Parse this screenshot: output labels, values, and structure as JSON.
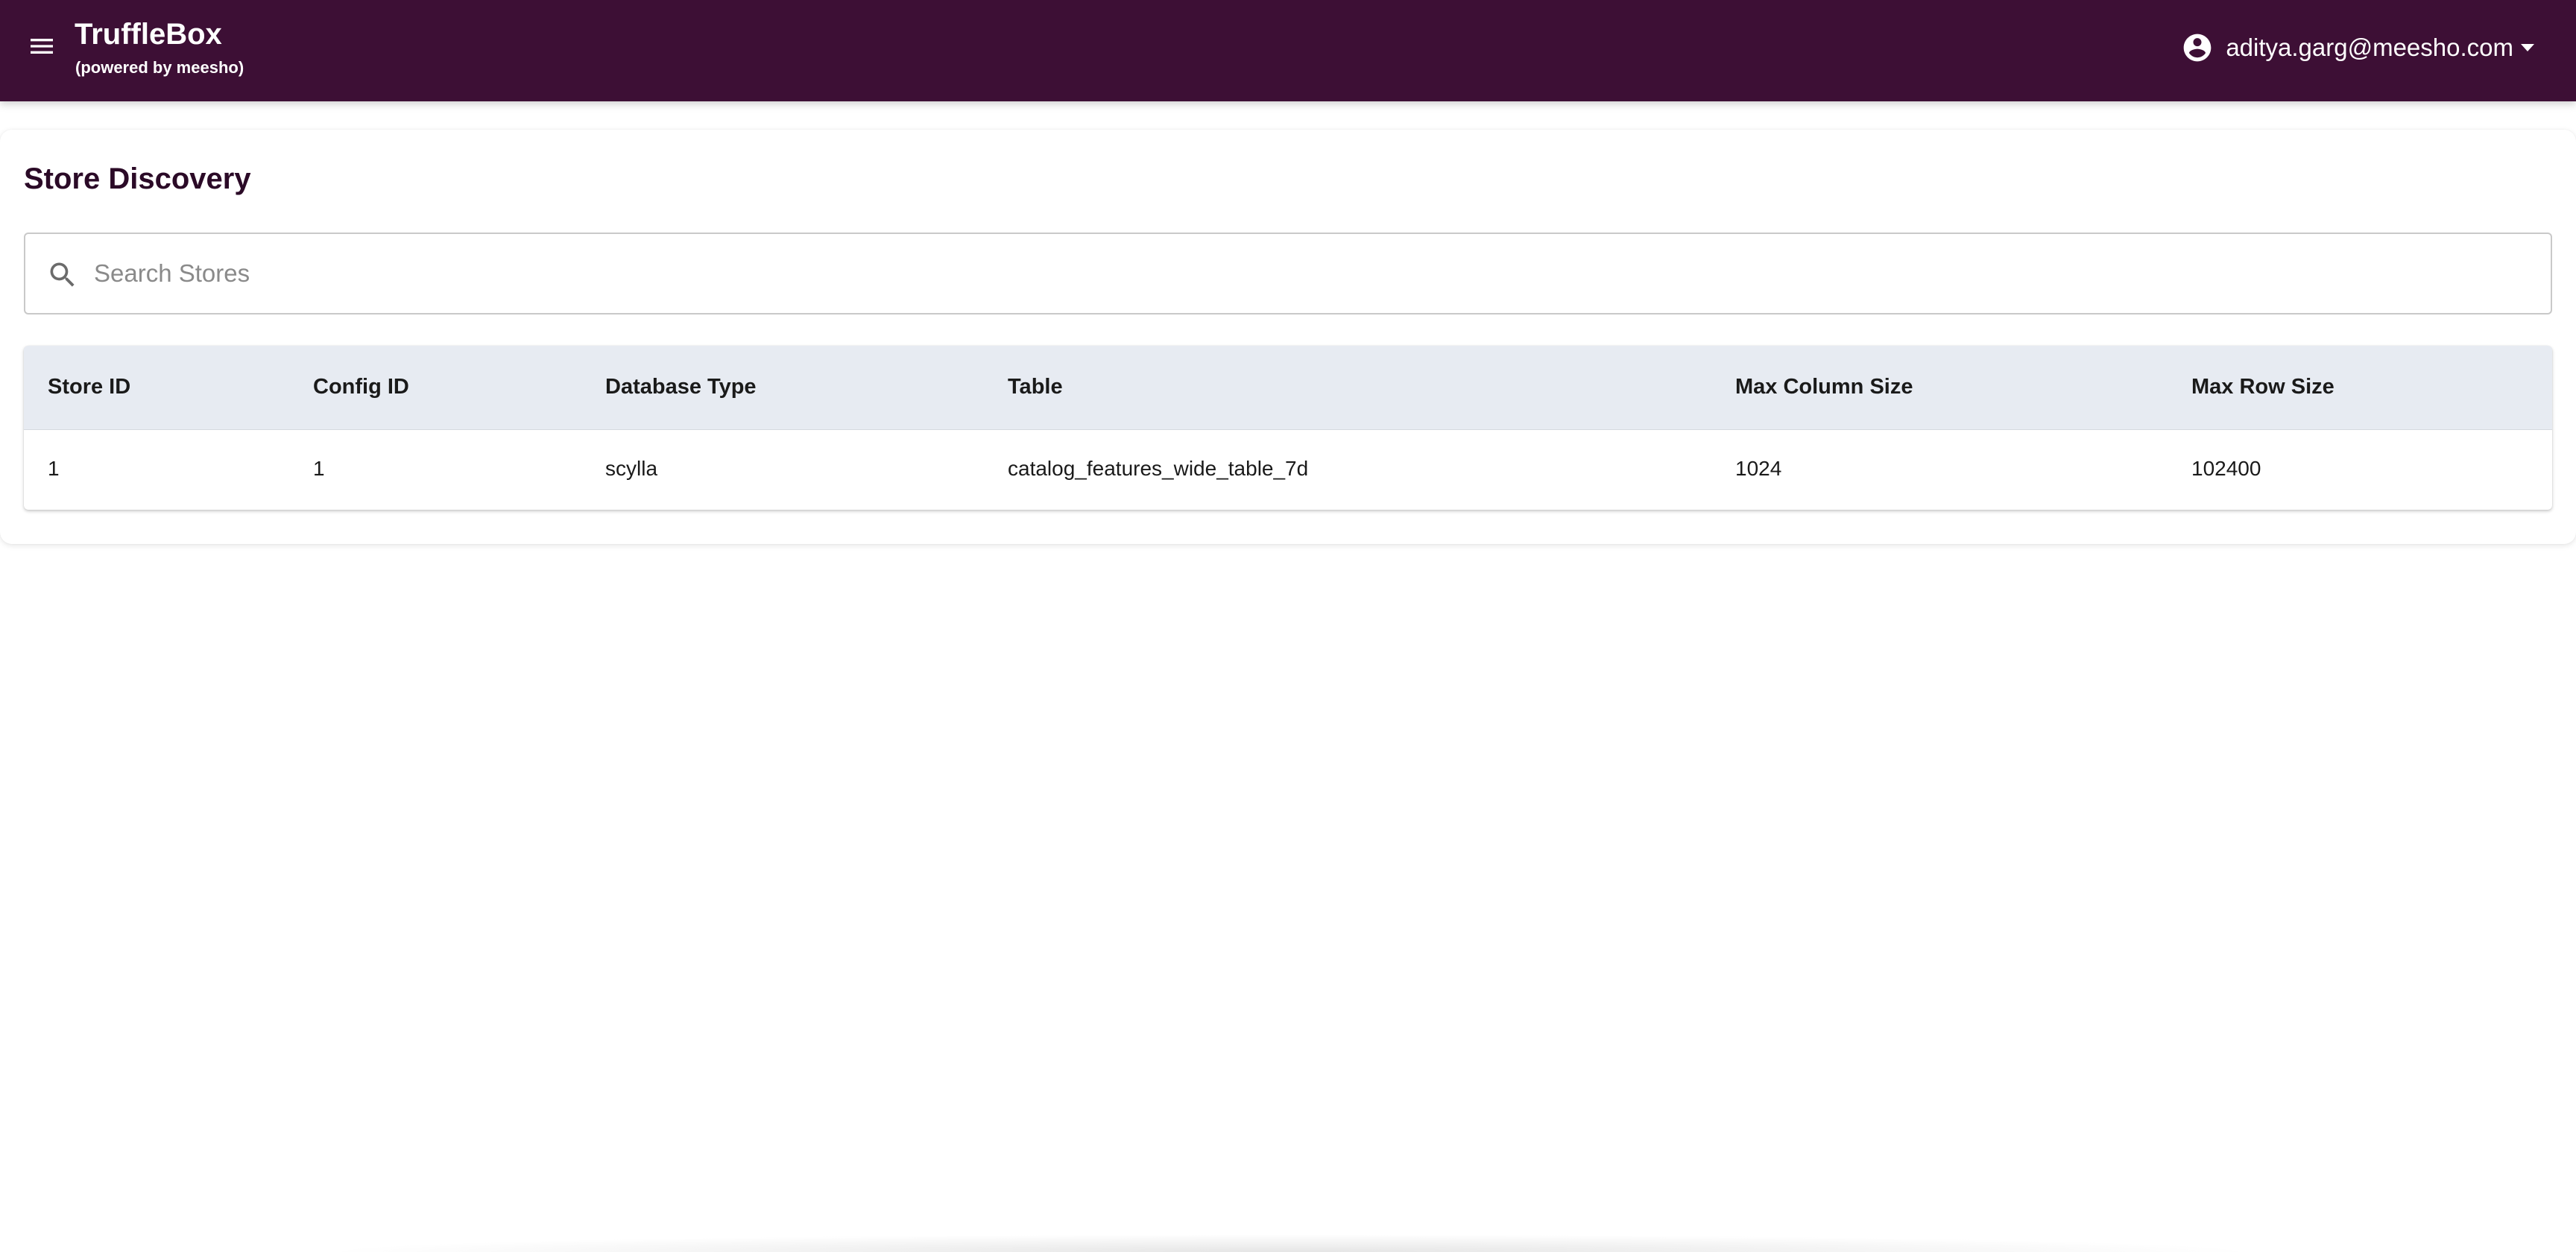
{
  "app": {
    "title": "TruffleBox",
    "subtitle": "(powered by meesho)",
    "menu_icon": "hamburger-menu-icon",
    "brand_color": "#3d0f35"
  },
  "user": {
    "email": "aditya.garg@meesho.com",
    "avatar_icon": "account-circle-icon",
    "dropdown_icon": "caret-down-icon"
  },
  "page": {
    "title": "Store Discovery"
  },
  "search": {
    "placeholder": "Search Stores",
    "value": "",
    "icon": "search-icon"
  },
  "table": {
    "headers": [
      "Store ID",
      "Config ID",
      "Database Type",
      "Table",
      "Max Column Size",
      "Max Row Size"
    ],
    "rows": [
      [
        "1",
        "1",
        "scylla",
        "catalog_features_wide_table_7d",
        "1024",
        "102400"
      ]
    ],
    "header_background": "#e7ebf2"
  }
}
